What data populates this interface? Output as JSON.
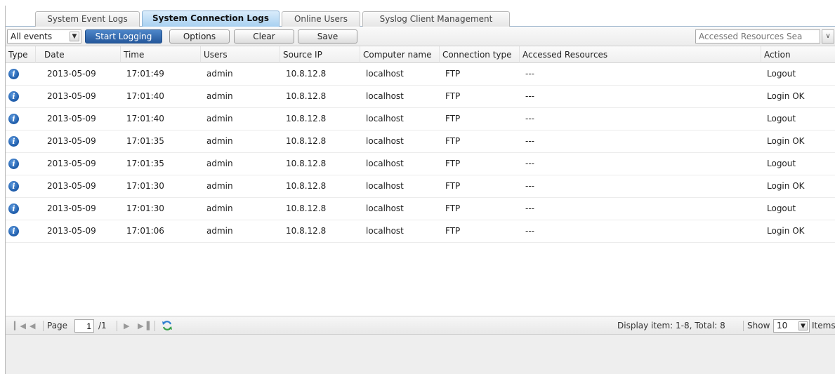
{
  "tabs": [
    {
      "label": "System Event Logs"
    },
    {
      "label": "System Connection Logs",
      "active": true
    },
    {
      "label": "Online Users"
    },
    {
      "label": "Syslog Client Management"
    }
  ],
  "toolbar": {
    "filter_value": "All events",
    "start_logging": "Start Logging",
    "options": "Options",
    "clear": "Clear",
    "save": "Save",
    "search_placeholder": "Accessed Resources Sea"
  },
  "columns": [
    "Type",
    "Date",
    "Time",
    "Users",
    "Source IP",
    "Computer name",
    "Connection type",
    "Accessed Resources",
    "Action"
  ],
  "rows": [
    {
      "type": "info-icon",
      "date": "2013-05-09",
      "time": "17:01:49",
      "user": "admin",
      "ip": "10.8.12.8",
      "computer": "localhost",
      "conn": "FTP",
      "resources": "---",
      "action": "Logout"
    },
    {
      "type": "info-icon",
      "date": "2013-05-09",
      "time": "17:01:40",
      "user": "admin",
      "ip": "10.8.12.8",
      "computer": "localhost",
      "conn": "FTP",
      "resources": "---",
      "action": "Login OK"
    },
    {
      "type": "info-icon",
      "date": "2013-05-09",
      "time": "17:01:40",
      "user": "admin",
      "ip": "10.8.12.8",
      "computer": "localhost",
      "conn": "FTP",
      "resources": "---",
      "action": "Logout"
    },
    {
      "type": "info-icon",
      "date": "2013-05-09",
      "time": "17:01:35",
      "user": "admin",
      "ip": "10.8.12.8",
      "computer": "localhost",
      "conn": "FTP",
      "resources": "---",
      "action": "Login OK"
    },
    {
      "type": "info-icon",
      "date": "2013-05-09",
      "time": "17:01:35",
      "user": "admin",
      "ip": "10.8.12.8",
      "computer": "localhost",
      "conn": "FTP",
      "resources": "---",
      "action": "Logout"
    },
    {
      "type": "info-icon",
      "date": "2013-05-09",
      "time": "17:01:30",
      "user": "admin",
      "ip": "10.8.12.8",
      "computer": "localhost",
      "conn": "FTP",
      "resources": "---",
      "action": "Login OK"
    },
    {
      "type": "info-icon",
      "date": "2013-05-09",
      "time": "17:01:30",
      "user": "admin",
      "ip": "10.8.12.8",
      "computer": "localhost",
      "conn": "FTP",
      "resources": "---",
      "action": "Logout"
    },
    {
      "type": "info-icon",
      "date": "2013-05-09",
      "time": "17:01:06",
      "user": "admin",
      "ip": "10.8.12.8",
      "computer": "localhost",
      "conn": "FTP",
      "resources": "---",
      "action": "Login OK"
    }
  ],
  "pager": {
    "page_label": "Page",
    "page_value": "1",
    "page_total": "/1",
    "display_info": "Display item: 1-8, Total: 8",
    "show_label": "Show",
    "show_value": "10",
    "items_label": "Items"
  },
  "colors": {
    "active_tab": "#a8d0f0",
    "primary_button": "#25589c",
    "info_icon": "#1c5aa8"
  }
}
